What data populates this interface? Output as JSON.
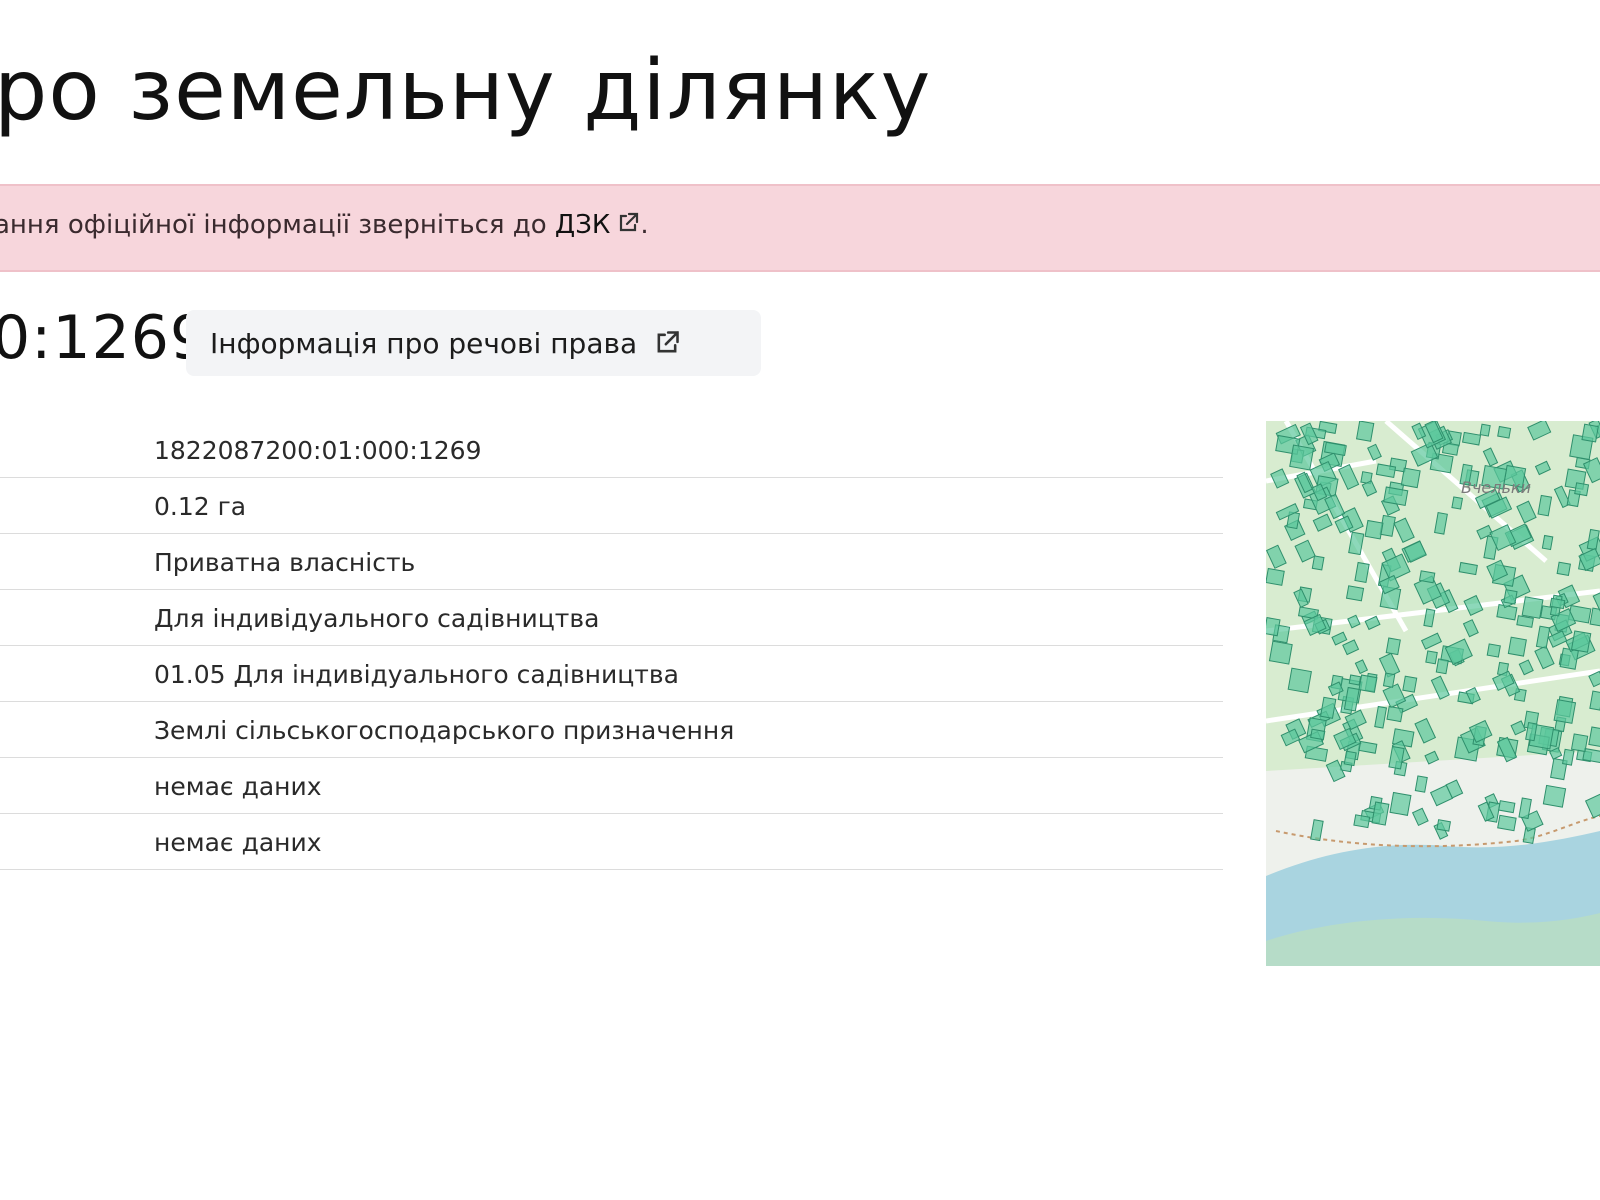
{
  "page": {
    "title": "ро земельну ділянку"
  },
  "alert": {
    "text": "ання офіційної інформації зверніться до ",
    "link_label": "ДЗК",
    "suffix": ".",
    "background": "#f7d6dc"
  },
  "parcel": {
    "cadastral_fragment": "0:1269",
    "rights_button_label": "Інформація про речові права"
  },
  "details": {
    "values": [
      "1822087200:01:000:1269",
      "0.12 га",
      "Приватна власність",
      "Для індивідуального садівництва",
      "01.05 Для індивідуального садівництва",
      "Землі сільськогосподарського призначення",
      "немає даних",
      "немає даних"
    ]
  },
  "map": {
    "place_label": "Вчельки",
    "parcel_color": "#5cc79d",
    "water_color": "#a9d4e0",
    "land_color": "#d8ecd0"
  },
  "icons": {
    "external": "external-link-icon"
  }
}
